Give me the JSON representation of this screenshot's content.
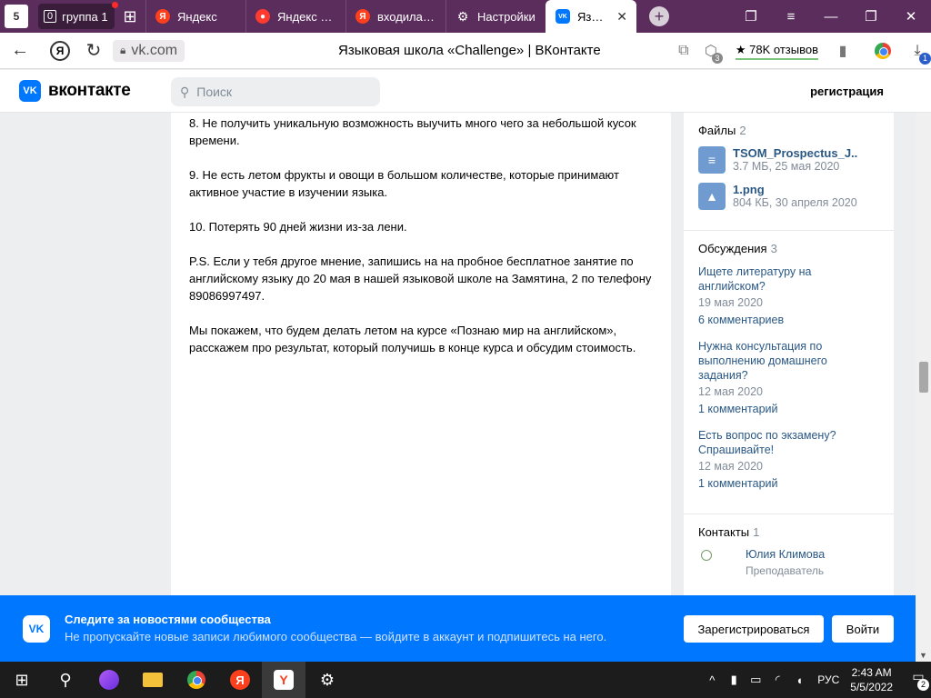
{
  "browser": {
    "home_badge": "5",
    "tab_group": {
      "count": "0",
      "label": "группа 1"
    },
    "tabs": [
      {
        "label": "Яндекс",
        "icon": "yandex-icon",
        "color": "#fc3f1d",
        "glyph": "Я"
      },
      {
        "label": "Яндекс Карты",
        "icon": "maps-pin-icon",
        "color": "#ff3b30",
        "glyph": "●"
      },
      {
        "label": "входила ли",
        "icon": "yandex-icon",
        "color": "#fc3f1d",
        "glyph": "Я"
      },
      {
        "label": "Настройки",
        "icon": "gear-icon",
        "color": "transparent",
        "glyph": "⚙"
      },
      {
        "label": "Языковая",
        "icon": "vk-icon",
        "color": "#0077ff",
        "glyph": "VK"
      }
    ],
    "active_tab_index": 4,
    "domain": "vk.com",
    "page_title": "Языковая школа «Challenge» | ВКонтакте",
    "reviews": "★ 78K отзывов",
    "extensions_badge": "3",
    "downloads_badge": "1"
  },
  "vk": {
    "logo_text": "вконтакте",
    "logo_glyph": "VK",
    "search_placeholder": "Поиск",
    "register_link": "регистрация"
  },
  "post": {
    "paragraphs": [
      "8. Не получить уникальную возможность выучить много чего за небольшой кусок времени.",
      "9. Не есть летом фрукты и овощи в большом количестве, которые принимают активное участие в изучении языка.",
      "10. Потерять 90 дней жизни из-за лени.",
      "P.S. Если у тебя другое мнение, запишись на на пробное бесплатное занятие по английскому языку до 20 мая в нашей языковой школе на Замятина, 2 по телефону 89086997497.",
      "Мы покажем, что будем делать летом на курсе «Познаю мир на английском», расскажем про результат, который получишь в конце курса и обсудим стоимость."
    ]
  },
  "sidebar": {
    "files": {
      "title": "Файлы",
      "count": "2",
      "items": [
        {
          "name": "TSOM_Prospectus_J..",
          "meta": "3.7 МБ, 25 мая 2020",
          "icon": "document-icon"
        },
        {
          "name": "1.png",
          "meta": "804 КБ, 30 апреля 2020",
          "icon": "image-icon"
        }
      ]
    },
    "discussions": {
      "title": "Обсуждения",
      "count": "3",
      "items": [
        {
          "title": "Ищете литературу на английском?",
          "date": "19 мая 2020",
          "comments": "6 комментариев"
        },
        {
          "title": "Нужна консультация по выполнению домашнего задания?",
          "date": "12 мая 2020",
          "comments": "1 комментарий"
        },
        {
          "title": "Есть вопрос по экзамену? Спрашивайте!",
          "date": "12 мая 2020",
          "comments": "1 комментарий"
        }
      ]
    },
    "contacts": {
      "title": "Контакты",
      "count": "1",
      "items": [
        {
          "name": "Юлия Климова",
          "role": "Преподаватель"
        }
      ]
    }
  },
  "banner": {
    "title": "Следите за новостями сообщества",
    "subtitle": "Не пропускайте новые записи любимого сообщества — войдите в аккаунт и подпишитесь на него.",
    "register_button": "Зарегистрироваться",
    "login_button": "Войти",
    "color": "#0077ff"
  },
  "taskbar": {
    "language": "РУС",
    "time": "2:43 AM",
    "date": "5/5/2022",
    "notifications": "2"
  }
}
